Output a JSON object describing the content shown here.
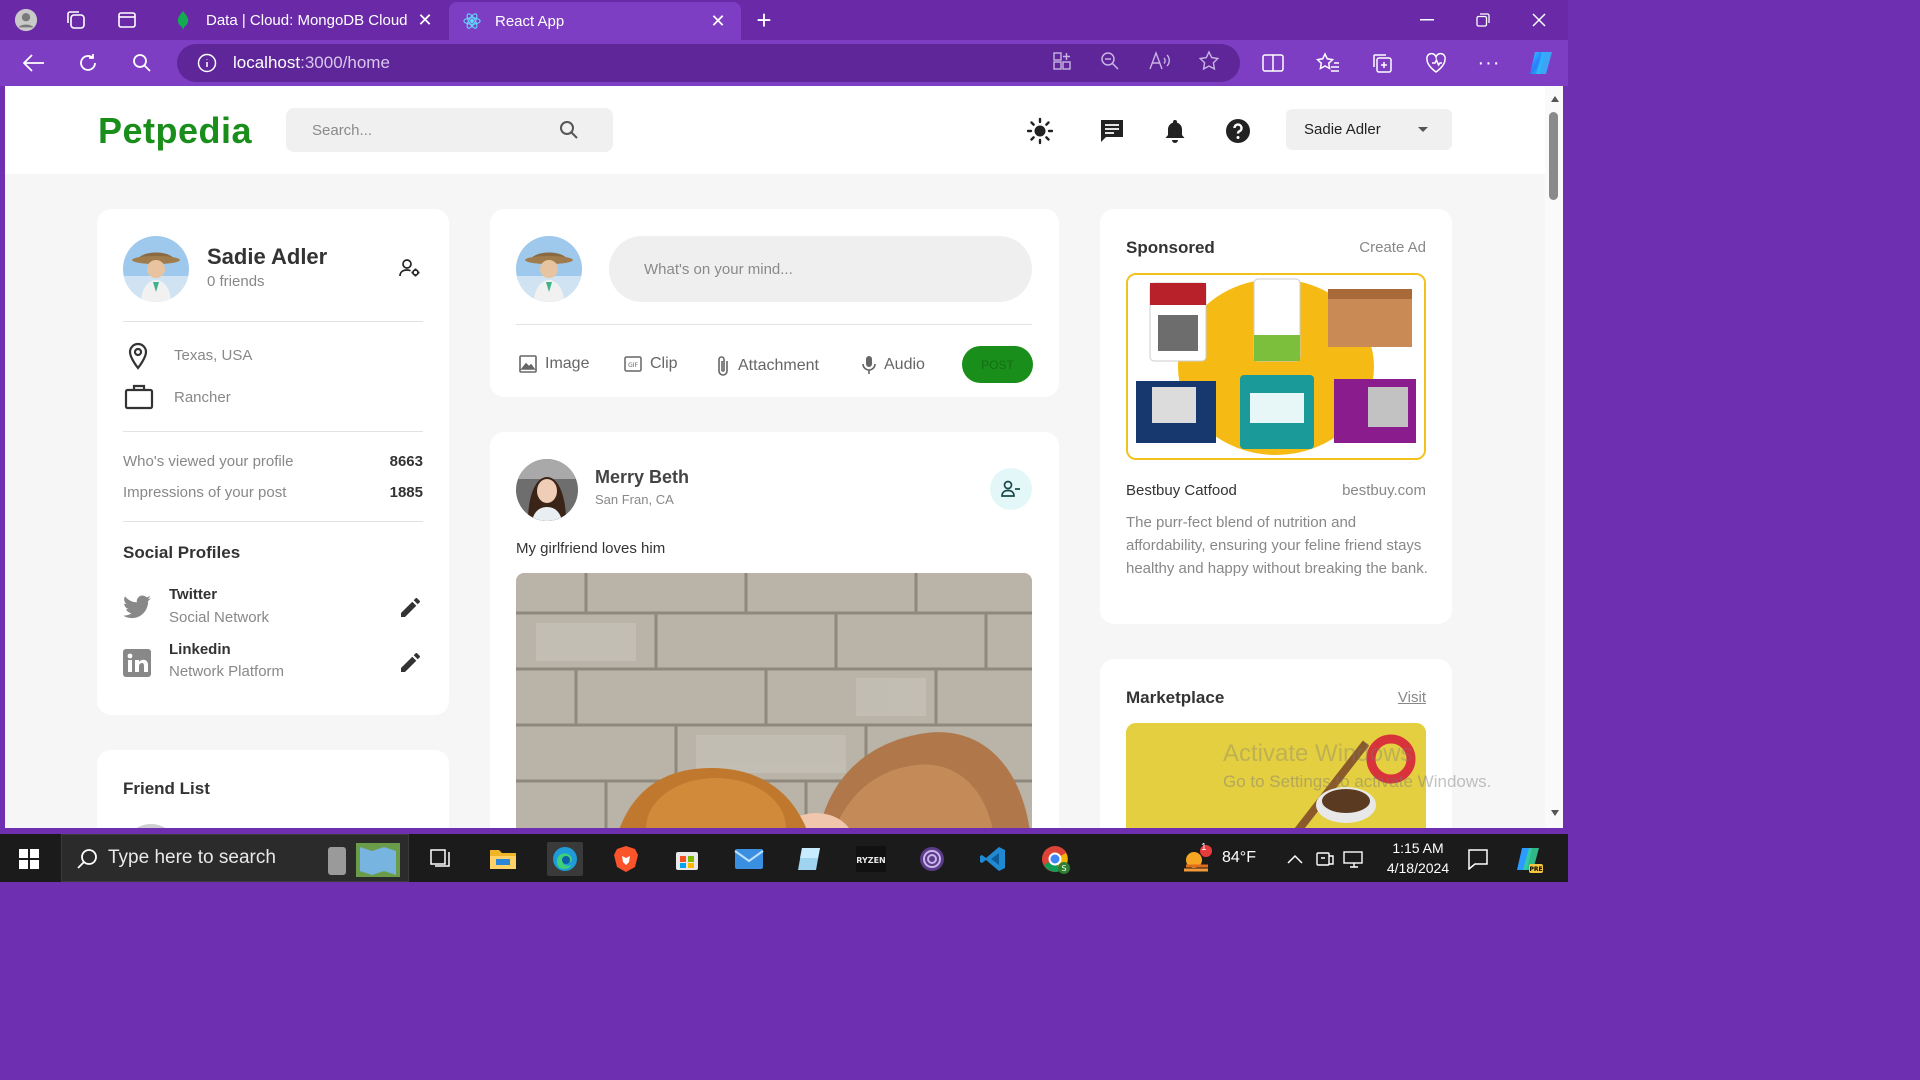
{
  "browser": {
    "tabs": [
      {
        "title": "Data | Cloud: MongoDB Cloud",
        "active": false
      },
      {
        "title": "React App",
        "active": true
      }
    ],
    "url_host": "localhost",
    "url_path": ":3000/home"
  },
  "app": {
    "brand": "Petpedia",
    "search_placeholder": "Search...",
    "user_menu": "Sadie Adler",
    "colors": {
      "brand": "#1a8e1a",
      "accent_purple": "#7d3ec4"
    }
  },
  "profile": {
    "name": "Sadie Adler",
    "friends": "0 friends",
    "location": "Texas, USA",
    "occupation": "Rancher",
    "viewed_label": "Who's viewed your profile",
    "viewed_value": "8663",
    "impressions_label": "Impressions of your post",
    "impressions_value": "1885",
    "social_heading": "Social Profiles",
    "socials": [
      {
        "name": "Twitter",
        "desc": "Social Network"
      },
      {
        "name": "Linkedin",
        "desc": "Network Platform"
      }
    ]
  },
  "friend_list": {
    "heading": "Friend List"
  },
  "composer": {
    "placeholder": "What's on your mind...",
    "actions": [
      "Image",
      "Clip",
      "Attachment",
      "Audio"
    ],
    "post_label": "POST"
  },
  "post": {
    "author": "Merry Beth",
    "location": "San Fran, CA",
    "text": "My girlfriend loves him"
  },
  "sponsored": {
    "heading": "Sponsored",
    "create_ad": "Create Ad",
    "product": "Bestbuy Catfood",
    "site": "bestbuy.com",
    "description": "The purr-fect blend of nutrition and affordability, ensuring your feline friend stays healthy and happy without breaking the bank."
  },
  "marketplace": {
    "heading": "Marketplace",
    "visit": "Visit"
  },
  "watermark": {
    "line1": "Activate Windows",
    "line2": "Go to Settings to activate Windows."
  },
  "taskbar": {
    "search_placeholder": "Type here to search",
    "weather": "84°F",
    "weather_badge": "1",
    "time": "1:15 AM",
    "date": "4/18/2024"
  }
}
